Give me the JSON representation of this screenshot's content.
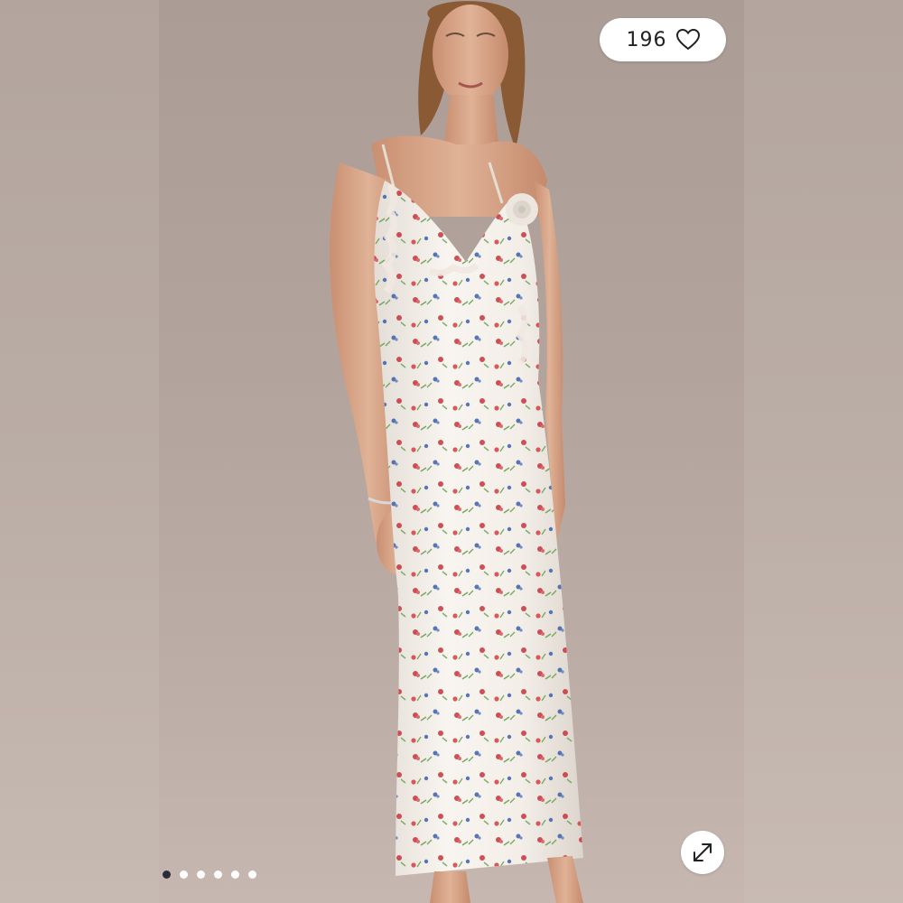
{
  "product_image": {
    "alt": "",
    "like_count": "196",
    "like_icon": "heart-outline-icon",
    "expand_icon": "expand-arrows-icon"
  },
  "carousel": {
    "total": 6,
    "active_index": 0
  },
  "colors": {
    "background": "#b9aca4",
    "dress": "#f4efe9",
    "skin": "#d9a98c",
    "hair": "#8a5a35",
    "flower_red": "#c8323a",
    "flower_blue": "#3b5fa8",
    "leaf_green": "#5f9b4a",
    "active_dot": "#2b2b3a"
  }
}
